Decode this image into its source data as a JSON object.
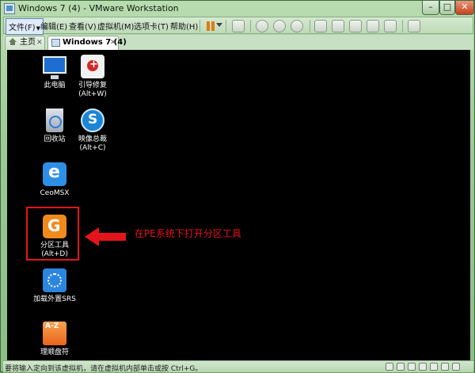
{
  "window": {
    "title": "Windows 7 (4) - VMware Workstation",
    "controls": {
      "minimize": "–",
      "maximize": "□",
      "close": "✕"
    }
  },
  "menubar": {
    "items": [
      "文件(F)",
      "编辑(E)",
      "查看(V)",
      "虚拟机(M)",
      "选项卡(T)",
      "帮助(H)"
    ]
  },
  "tabs": [
    {
      "label": "主页",
      "close": "✕",
      "active": false
    },
    {
      "label": "Windows 7 (4)",
      "close": "✕",
      "active": true
    }
  ],
  "desktop_icons": [
    {
      "label": "此电脑"
    },
    {
      "label": "引导修复",
      "shortcut": "(Alt+W)"
    },
    {
      "label": "回收站"
    },
    {
      "label": "映像总裁",
      "shortcut": "(Alt+C)"
    },
    {
      "label": "CeoMSX"
    },
    {
      "label": "分区工具",
      "shortcut": "(Alt+D)"
    },
    {
      "label": "加载外置SRS"
    },
    {
      "label": "理顺盘符"
    }
  ],
  "annotation": {
    "text": "在PE系统下打开分区工具",
    "color": "#e5141b"
  },
  "statusbar": {
    "text": "要将输入定向到该虚拟机，请在虚拟机内部单击或按 Ctrl+G。"
  }
}
